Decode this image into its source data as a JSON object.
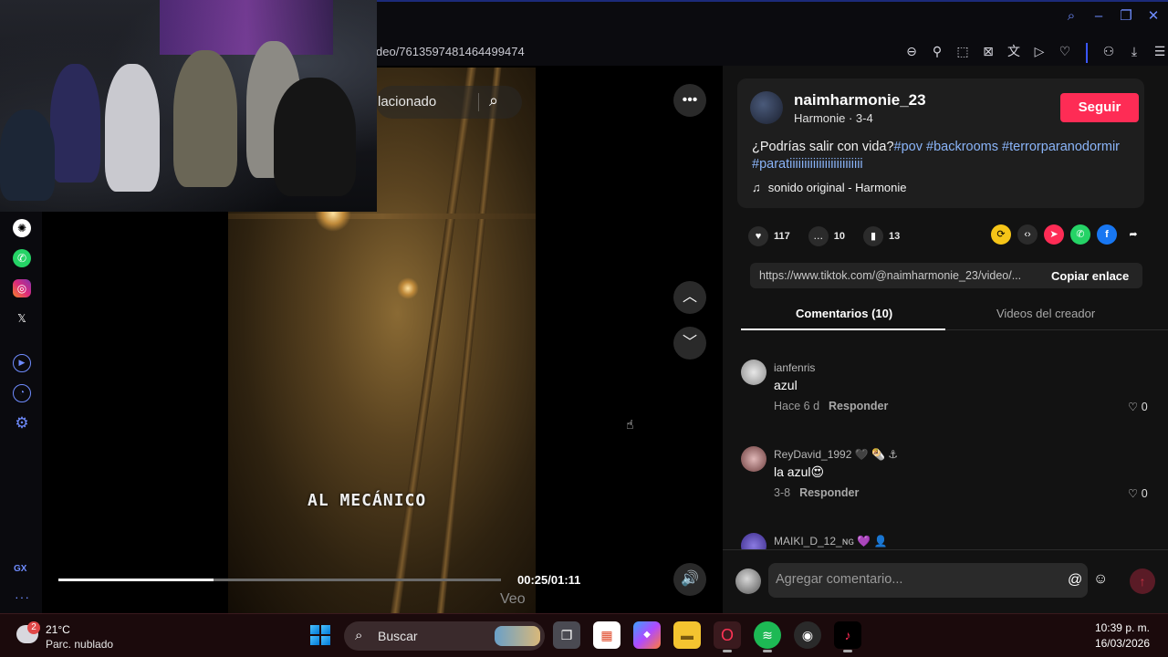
{
  "browser": {
    "url": "deo/7613597481464499474",
    "colors": {
      "accent": "#6f8cff"
    }
  },
  "video": {
    "search_text": "lacionado",
    "caption": "AL MECÁNICO",
    "time": "00:25/01:11",
    "progress": 0.35,
    "veo_text": "Veo"
  },
  "author": {
    "username": "naimharmonie_23",
    "subtitle": "Harmonie · 3-4",
    "follow_label": "Seguir"
  },
  "description": {
    "text": "¿Podrías salir con vida?",
    "hashtags": [
      "#pov",
      "#backrooms",
      "#terrorparanodormir",
      "#paratiiiiiiiiiiiiiiiiiiiiiiiii"
    ],
    "music": "sonido original - Harmonie"
  },
  "stats": {
    "likes": "117",
    "comments": "10",
    "saves": "13"
  },
  "share": {
    "link": "https://www.tiktok.com/@naimharmonie_23/video/...",
    "copy_label": "Copiar enlace"
  },
  "tabs": {
    "comments": "Comentarios (10)",
    "creator_videos": "Videos del creador"
  },
  "comments": [
    {
      "user": "ianfenris",
      "text": "azul",
      "time": "Hace 6 d",
      "reply": "Responder",
      "likes": "0"
    },
    {
      "user": "ReyDavid_1992",
      "user_suffix": "🖤 🌯 ⚓",
      "text": "la azul😍",
      "time": "3-8",
      "reply": "Responder",
      "likes": "0"
    },
    {
      "user": "MAIKI_D_12_ɴɢ",
      "user_suffix": "💜 👤",
      "text": "",
      "time": "",
      "reply": "",
      "likes": ""
    }
  ],
  "comment_input": {
    "placeholder": "Agregar comentario..."
  },
  "taskbar": {
    "weather_badge": "2",
    "temperature": "21°C",
    "condition": "Parc. nublado",
    "search_label": "Buscar",
    "time": "10:39 p. m.",
    "date": "16/03/2026"
  },
  "sidebar": {
    "gx_label": "GX"
  }
}
